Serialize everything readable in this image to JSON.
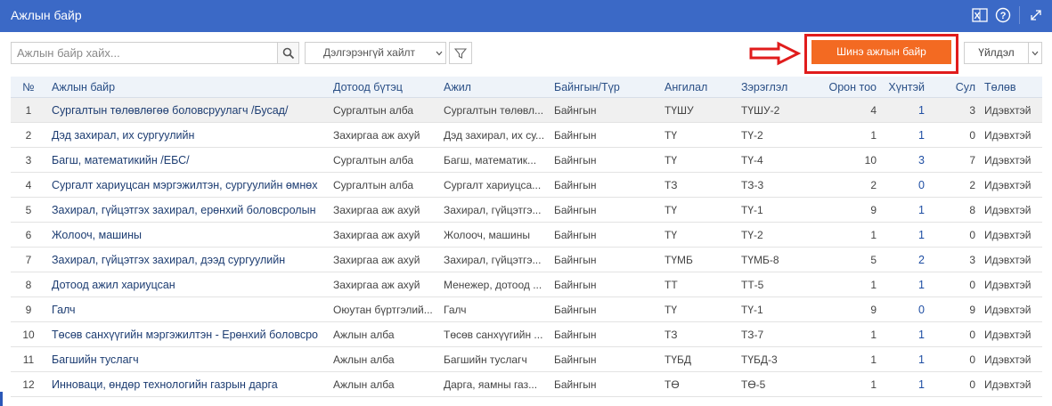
{
  "window": {
    "title": "Ажлын байр"
  },
  "toolbar": {
    "search_placeholder": "Ажлын байр хайх...",
    "advanced_search_label": "Дэлгэрэнгүй хайлт",
    "new_button_label": "Шинэ ажлын байр",
    "action_label": "Үйлдэл"
  },
  "colors": {
    "header": "#3b69c6",
    "accent_button": "#f36a22",
    "highlight_border": "#e01c1c",
    "link_text": "#1d3d72"
  },
  "icons": [
    "excel-icon",
    "help-icon",
    "expand-icon",
    "search-icon",
    "chevron-down-icon",
    "filter-icon",
    "arrow-right-icon"
  ],
  "table": {
    "columns": [
      "№",
      "Ажлын байр",
      "Дотоод бүтэц",
      "Ажил",
      "Байнгын/Түр",
      "Ангилал",
      "Зэрэглэл",
      "Орон тоо",
      "Хүнтэй",
      "Сул",
      "Төлөв"
    ],
    "rows": [
      {
        "no": "1",
        "title": "Сургалтын төлөвлөгөө боловсруулагч /Бусад/",
        "unit": "Сургалтын алба",
        "job": "Сургалтын төлөвл...",
        "type": "Байнгын",
        "category": "ТҮШУ",
        "rank": "ТҮШУ-2",
        "seats": "4",
        "filled": "1",
        "vacant": "3",
        "status": "Идэвхтэй"
      },
      {
        "no": "2",
        "title": "Дэд захирал, их сургуулийн",
        "unit": "Захиргаа аж ахуй",
        "job": "Дэд захирал, их су...",
        "type": "Байнгын",
        "category": "ТҮ",
        "rank": "ТҮ-2",
        "seats": "1",
        "filled": "1",
        "vacant": "0",
        "status": "Идэвхтэй"
      },
      {
        "no": "3",
        "title": "Багш, математикийн /ЕБС/",
        "unit": "Сургалтын алба",
        "job": "Багш, математик...",
        "type": "Байнгын",
        "category": "ТҮ",
        "rank": "ТҮ-4",
        "seats": "10",
        "filled": "3",
        "vacant": "7",
        "status": "Идэвхтэй"
      },
      {
        "no": "4",
        "title": "Сургалт хариуцсан мэргэжилтэн, сургуулийн өмнөх",
        "unit": "Сургалтын алба",
        "job": "Сургалт хариуцса...",
        "type": "Байнгын",
        "category": "ТЗ",
        "rank": "ТЗ-3",
        "seats": "2",
        "filled": "0",
        "vacant": "2",
        "status": "Идэвхтэй"
      },
      {
        "no": "5",
        "title": "Захирал, гүйцэтгэх захирал, ерөнхий боловсролын",
        "unit": "Захиргаа аж ахуй",
        "job": "Захирал, гүйцэтгэ...",
        "type": "Байнгын",
        "category": "ТҮ",
        "rank": "ТҮ-1",
        "seats": "9",
        "filled": "1",
        "vacant": "8",
        "status": "Идэвхтэй"
      },
      {
        "no": "6",
        "title": "Жолооч, машины",
        "unit": "Захиргаа аж ахуй",
        "job": "Жолооч, машины",
        "type": "Байнгын",
        "category": "ТҮ",
        "rank": "ТҮ-2",
        "seats": "1",
        "filled": "1",
        "vacant": "0",
        "status": "Идэвхтэй"
      },
      {
        "no": "7",
        "title": "Захирал, гүйцэтгэх захирал, дээд сургуулийн",
        "unit": "Захиргаа аж ахуй",
        "job": "Захирал, гүйцэтгэ...",
        "type": "Байнгын",
        "category": "ТҮМБ",
        "rank": "ТҮМБ-8",
        "seats": "5",
        "filled": "2",
        "vacant": "3",
        "status": "Идэвхтэй"
      },
      {
        "no": "8",
        "title": "Дотоод ажил хариуцсан",
        "unit": "Захиргаа аж ахуй",
        "job": "Менежер, дотоод ...",
        "type": "Байнгын",
        "category": "ТТ",
        "rank": "ТТ-5",
        "seats": "1",
        "filled": "1",
        "vacant": "0",
        "status": "Идэвхтэй"
      },
      {
        "no": "9",
        "title": "Галч",
        "unit": "Оюутан бүртгэлий...",
        "job": "Галч",
        "type": "Байнгын",
        "category": "ТҮ",
        "rank": "ТҮ-1",
        "seats": "9",
        "filled": "0",
        "vacant": "9",
        "status": "Идэвхтэй"
      },
      {
        "no": "10",
        "title": "Төсөв санхүүгийн мэргэжилтэн - Ерөнхий боловсро",
        "unit": "Ажлын алба",
        "job": "Төсөв санхүүгийн ...",
        "type": "Байнгын",
        "category": "ТЗ",
        "rank": "ТЗ-7",
        "seats": "1",
        "filled": "1",
        "vacant": "0",
        "status": "Идэвхтэй"
      },
      {
        "no": "11",
        "title": "Багшийн туслагч",
        "unit": "Ажлын алба",
        "job": "Багшийн туслагч",
        "type": "Байнгын",
        "category": "ТҮБД",
        "rank": "ТҮБД-3",
        "seats": "1",
        "filled": "1",
        "vacant": "0",
        "status": "Идэвхтэй"
      },
      {
        "no": "12",
        "title": "Инноваци, өндөр технологийн газрын дарга",
        "unit": "Ажлын алба",
        "job": "Дарга, яамны газ...",
        "type": "Байнгын",
        "category": "ТӨ",
        "rank": "ТӨ-5",
        "seats": "1",
        "filled": "1",
        "vacant": "0",
        "status": "Идэвхтэй"
      }
    ]
  }
}
